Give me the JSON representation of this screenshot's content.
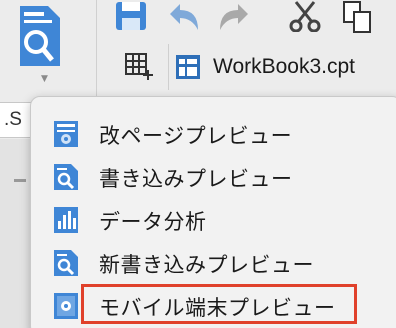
{
  "toolbar": {
    "preview_dropdown_icon": "preview-magnifier-icon",
    "save_icon": "save-icon",
    "undo_icon": "undo-icon",
    "redo_icon": "redo-icon",
    "cut_icon": "scissors-icon",
    "copy_icon": "copy-icon",
    "grid_add_icon": "table-add-icon"
  },
  "tab": {
    "label": "WorkBook3.cpt",
    "icon": "report-grid-icon"
  },
  "left_field": {
    "text": ".S"
  },
  "menu": {
    "items": [
      {
        "label": "改ページプレビュー",
        "icon": "page-break-preview-icon"
      },
      {
        "label": "書き込みプレビュー",
        "icon": "write-preview-icon"
      },
      {
        "label": "データ分析",
        "icon": "data-analysis-icon"
      },
      {
        "label": "新書き込みプレビュー",
        "icon": "new-write-preview-icon"
      },
      {
        "label": "モバイル端末プレビュー",
        "icon": "mobile-preview-icon",
        "highlighted": true
      }
    ]
  },
  "colors": {
    "icon_blue": "#3f86d6",
    "highlight_red": "#e0412b",
    "menu_bg": "#f2f2f2"
  }
}
